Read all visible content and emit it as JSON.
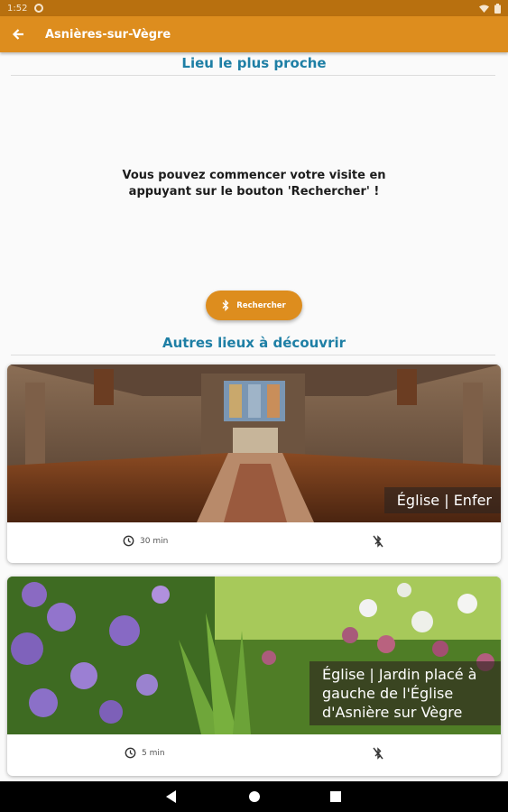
{
  "status_bar": {
    "time": "1:52"
  },
  "app_bar": {
    "title": "Asnières-sur-Vègre"
  },
  "nearest": {
    "title": "Lieu le plus proche",
    "message": "Vous pouvez commencer votre visite en appuyant sur le bouton 'Rechercher' !",
    "search_button": "Rechercher"
  },
  "others": {
    "title": "Autres lieux à découvrir",
    "places": [
      {
        "name": "Église | Enfer",
        "duration": "30 min"
      },
      {
        "name": "Église | Jardin placé à gauche de l'Église d'Asnière sur Vègre",
        "duration": "5 min"
      }
    ]
  },
  "colors": {
    "accent": "#dd8d1e",
    "status": "#b8700f",
    "title_blue": "#1e7fa5"
  }
}
